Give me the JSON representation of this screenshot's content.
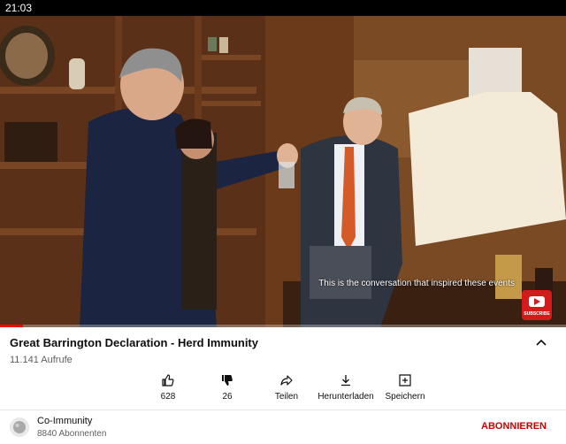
{
  "status_bar": {
    "time": "21:03"
  },
  "player": {
    "caption": "This is the conversation that inspired these events",
    "subscribe_label": "SUBSCRIBE",
    "progress": 0.04,
    "accent": "#ff0000"
  },
  "video": {
    "title": "Great Barrington Declaration - Herd Immunity",
    "views": "11.141 Aufrufe",
    "expand_icon": "chevron-up-icon"
  },
  "actions": [
    {
      "label": "628",
      "icon": "thumbs-up-icon"
    },
    {
      "label": "26",
      "icon": "thumbs-down-icon"
    },
    {
      "label": "Teilen",
      "icon": "share-icon"
    },
    {
      "label": "Herunterladen",
      "icon": "download-icon"
    },
    {
      "label": "Speichern",
      "icon": "save-playlist-icon"
    }
  ],
  "channel": {
    "name": "Co-Immunity",
    "subscribers": "8840 Abonnenten",
    "subscribe_label": "ABONNIEREN",
    "subscribe_color": "#cc0000"
  }
}
